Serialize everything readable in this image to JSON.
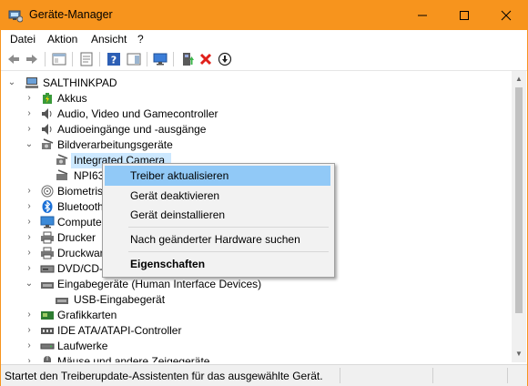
{
  "window": {
    "title": "Geräte-Manager"
  },
  "menu": [
    "Datei",
    "Aktion",
    "Ansicht",
    "?"
  ],
  "tree": {
    "root": "SALTHINKPAD",
    "items": [
      "Akkus",
      "Audio, Video und Gamecontroller",
      "Audioeingänge und -ausgänge",
      "Bildverarbeitungsgeräte",
      "Integrated Camera",
      "NPI63",
      "Biometris",
      "Bluetooth",
      "Computer",
      "Drucker",
      "Druckwart",
      "DVD/CD-R",
      "Eingabegeräte (Human Interface Devices)",
      "USB-Eingabegerät",
      "Grafikkarten",
      "IDE ATA/ATAPI-Controller",
      "Laufwerke",
      "Mäuse und andere Zeigegeräte"
    ]
  },
  "context_menu": {
    "update": "Treiber aktualisieren",
    "disable": "Gerät deaktivieren",
    "uninstall": "Gerät deinstallieren",
    "scan": "Nach geänderter Hardware suchen",
    "properties": "Eigenschaften"
  },
  "status": {
    "text": "Startet den Treiberupdate-Assistenten für das ausgewählte Gerät."
  }
}
